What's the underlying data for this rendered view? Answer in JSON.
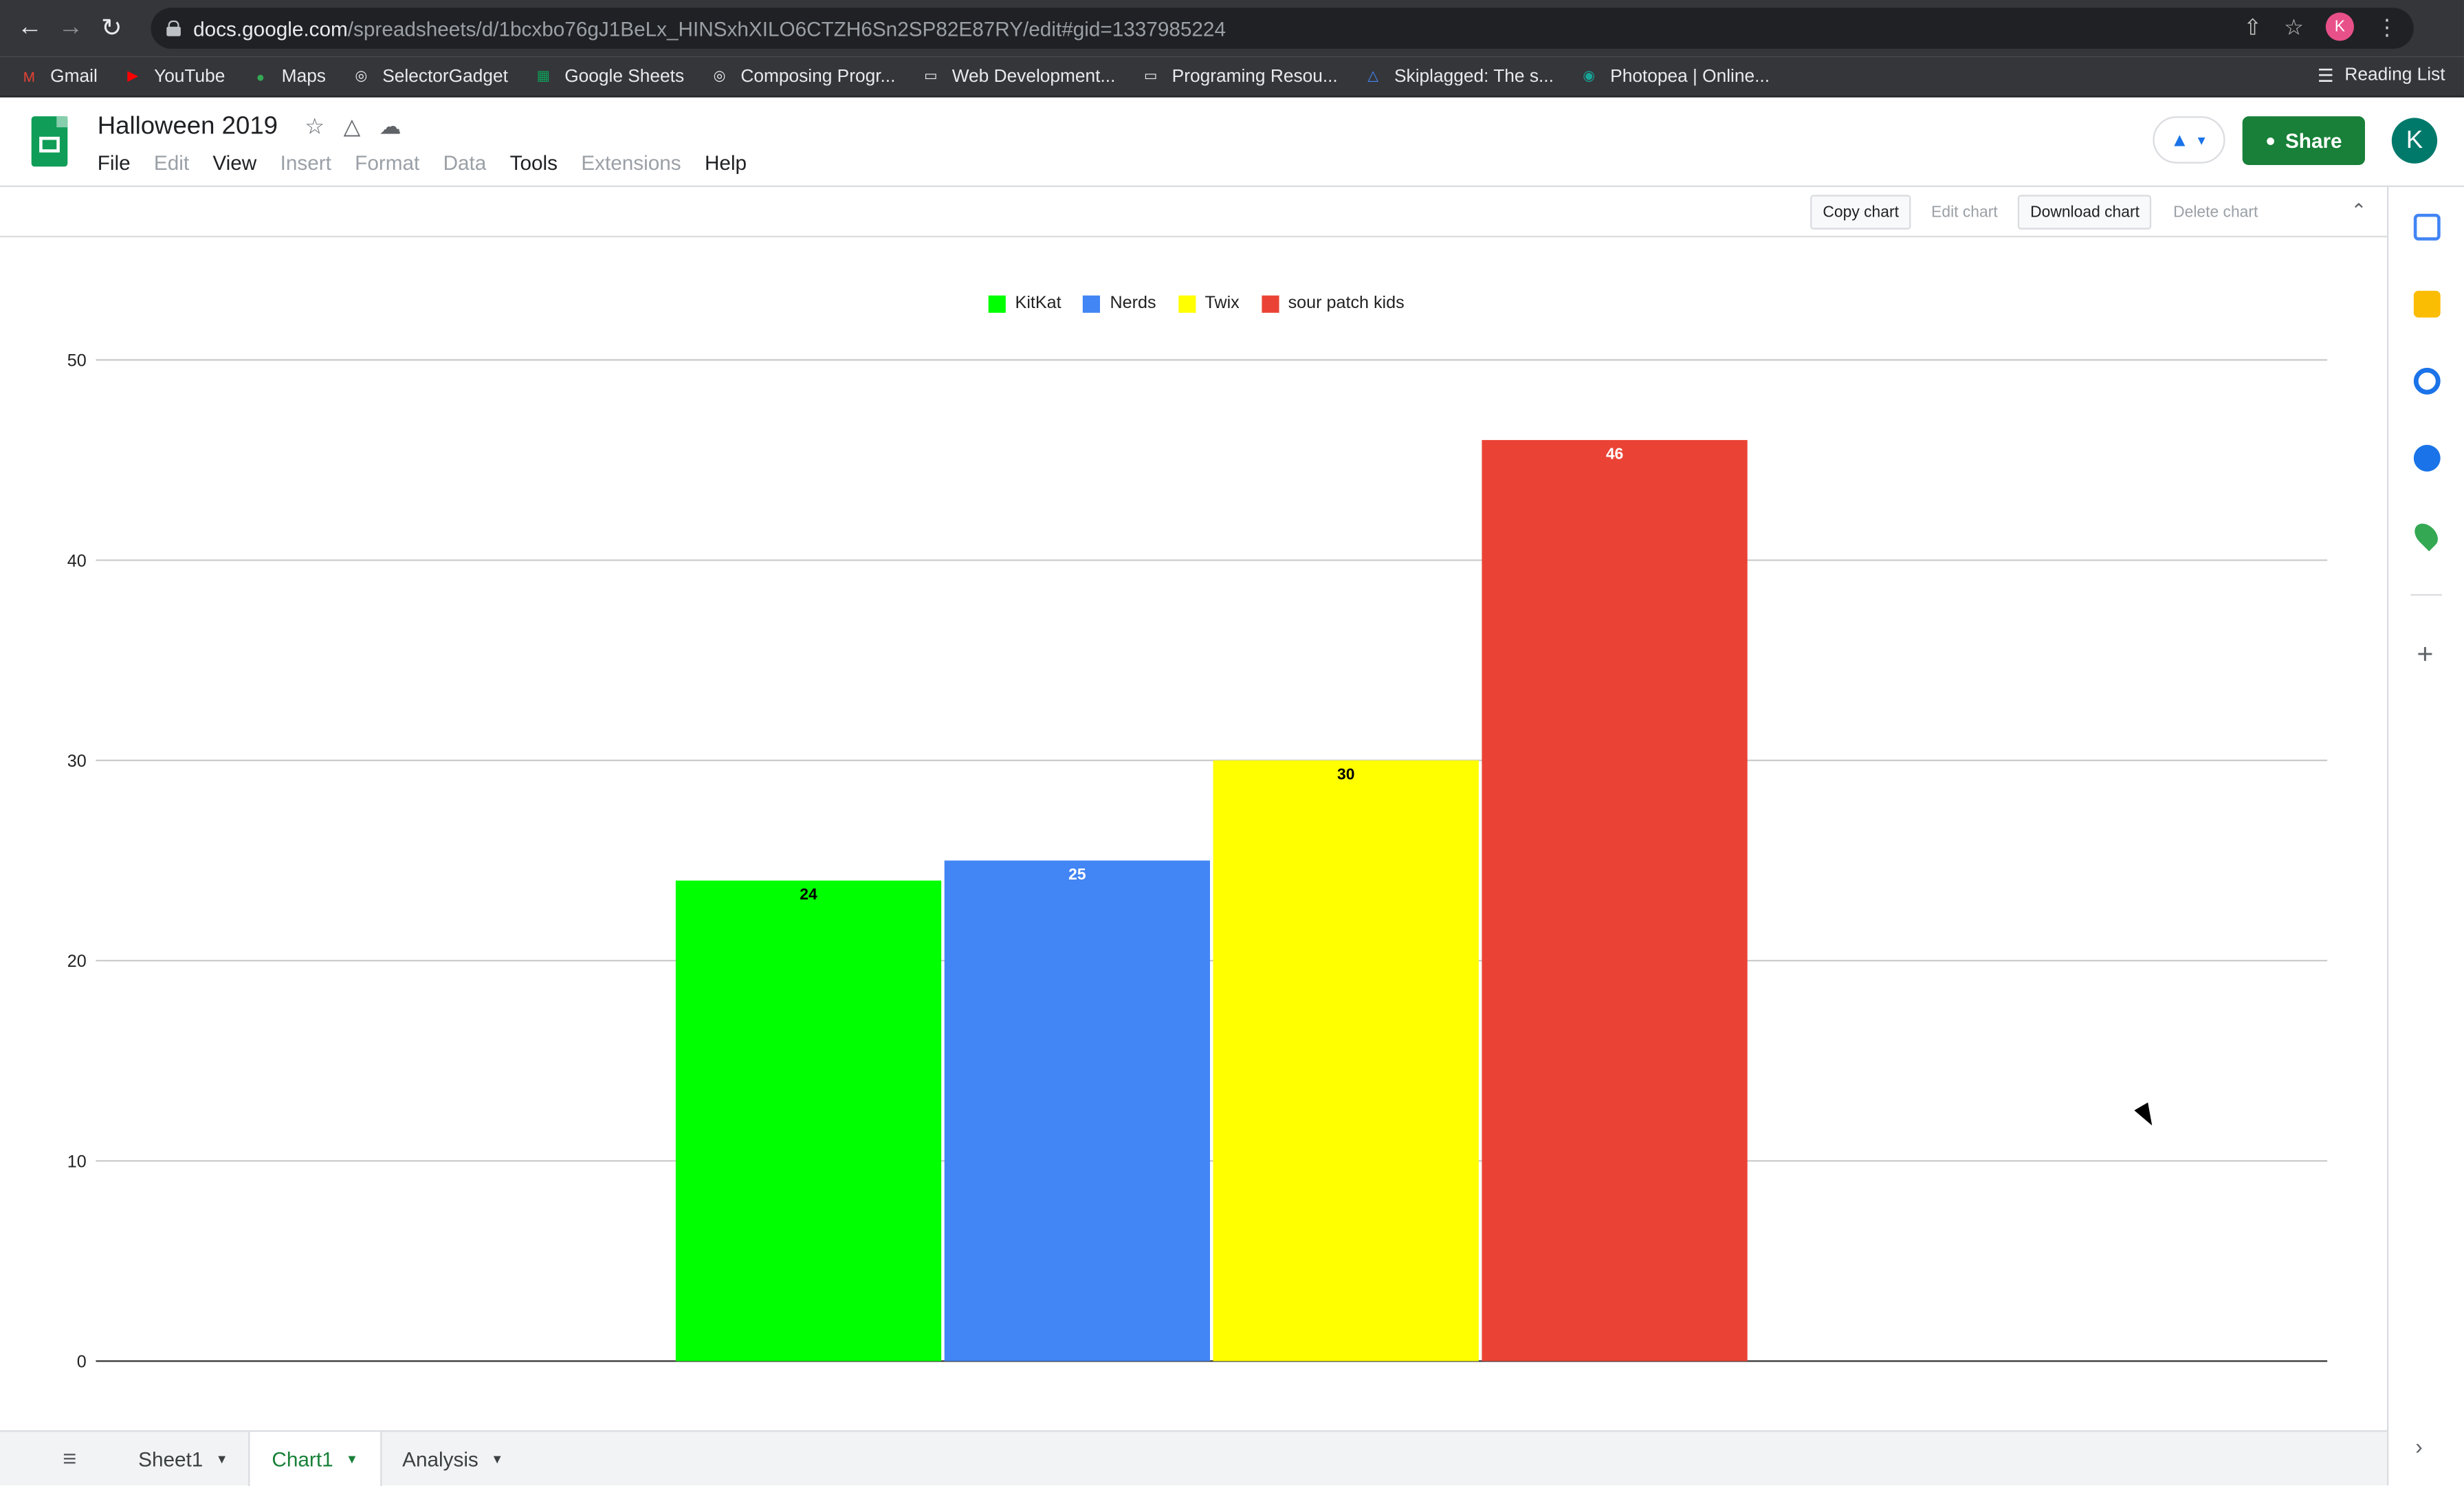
{
  "browser": {
    "url_host": "docs.google.com",
    "url_rest": "/spreadsheets/d/1bcxbo76gJ1BeLx_HINSxhXILO6CTZH6Sn2SP82E87RY/edit#gid=1337985224",
    "profile_initial": "K",
    "bookmarks": [
      {
        "label": "Gmail",
        "icon": "gmail-icon",
        "color": "#ea4335"
      },
      {
        "label": "YouTube",
        "icon": "youtube-icon",
        "color": "#ff0000"
      },
      {
        "label": "Maps",
        "icon": "maps-icon",
        "color": "#34a853"
      },
      {
        "label": "SelectorGadget",
        "icon": "globe-icon",
        "color": "#e8eaed"
      },
      {
        "label": "Google Sheets",
        "icon": "sheets-icon",
        "color": "#0f9d58"
      },
      {
        "label": "Composing Progr...",
        "icon": "globe-icon",
        "color": "#e8eaed"
      },
      {
        "label": "Web Development...",
        "icon": "folder-icon",
        "color": "#e8eaed"
      },
      {
        "label": "Programing Resou...",
        "icon": "folder-icon",
        "color": "#e8eaed"
      },
      {
        "label": "Skiplagged: The s...",
        "icon": "skiplagged-icon",
        "color": "#4285f4"
      },
      {
        "label": "Photopea | Online...",
        "icon": "photopea-icon",
        "color": "#18a497"
      }
    ],
    "reading_list": "Reading List"
  },
  "sheets": {
    "title": "Halloween 2019",
    "menu": [
      {
        "label": "File",
        "enabled": true
      },
      {
        "label": "Edit",
        "enabled": false
      },
      {
        "label": "View",
        "enabled": true
      },
      {
        "label": "Insert",
        "enabled": false
      },
      {
        "label": "Format",
        "enabled": false
      },
      {
        "label": "Data",
        "enabled": false
      },
      {
        "label": "Tools",
        "enabled": true
      },
      {
        "label": "Extensions",
        "enabled": false
      },
      {
        "label": "Help",
        "enabled": true
      }
    ],
    "share_label": "Share",
    "avatar_initial": "K",
    "colors": {
      "share": "#188038",
      "accent": "#1a73e8"
    }
  },
  "chart_toolbar": {
    "copy": "Copy chart",
    "edit": "Edit chart",
    "download": "Download chart",
    "delete": "Delete chart"
  },
  "chart_data": {
    "type": "bar",
    "series": [
      {
        "name": "KitKat",
        "values": [
          24
        ],
        "color": "#00ff00",
        "label_color": "#000000"
      },
      {
        "name": "Nerds",
        "values": [
          25
        ],
        "color": "#4285f4",
        "label_color": "#ffffff"
      },
      {
        "name": "Twix",
        "values": [
          30
        ],
        "color": "#ffff00",
        "label_color": "#000000"
      },
      {
        "name": "sour patch kids",
        "values": [
          46
        ],
        "color": "#ea4335",
        "label_color": "#ffffff"
      }
    ],
    "ylim": [
      0,
      50
    ],
    "yticks": [
      0,
      10,
      20,
      30,
      40,
      50
    ],
    "grid": true,
    "legend_position": "top"
  },
  "sheet_tabs": [
    {
      "label": "Sheet1",
      "active": false
    },
    {
      "label": "Chart1",
      "active": true
    },
    {
      "label": "Analysis",
      "active": false
    }
  ]
}
